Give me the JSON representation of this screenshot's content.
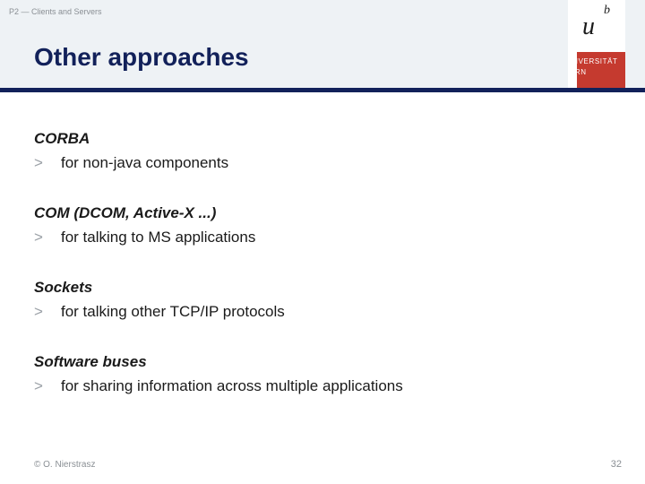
{
  "breadcrumb": "P2 — Clients and Servers",
  "title": "Other approaches",
  "logo": {
    "u": "u",
    "b": "b",
    "uni": "UNIVERSITÄT",
    "bern": "BERN"
  },
  "sections": [
    {
      "head": "CORBA",
      "item": "for non-java components"
    },
    {
      "head": "COM (DCOM, Active-X ...)",
      "item": "for talking to MS applications"
    },
    {
      "head": "Sockets",
      "item": "for talking other TCP/IP protocols"
    },
    {
      "head": "Software buses",
      "item": "for sharing information across multiple applications"
    }
  ],
  "bullet_marker": ">",
  "footer": {
    "copyright": "© O. Nierstrasz",
    "page": "32"
  }
}
